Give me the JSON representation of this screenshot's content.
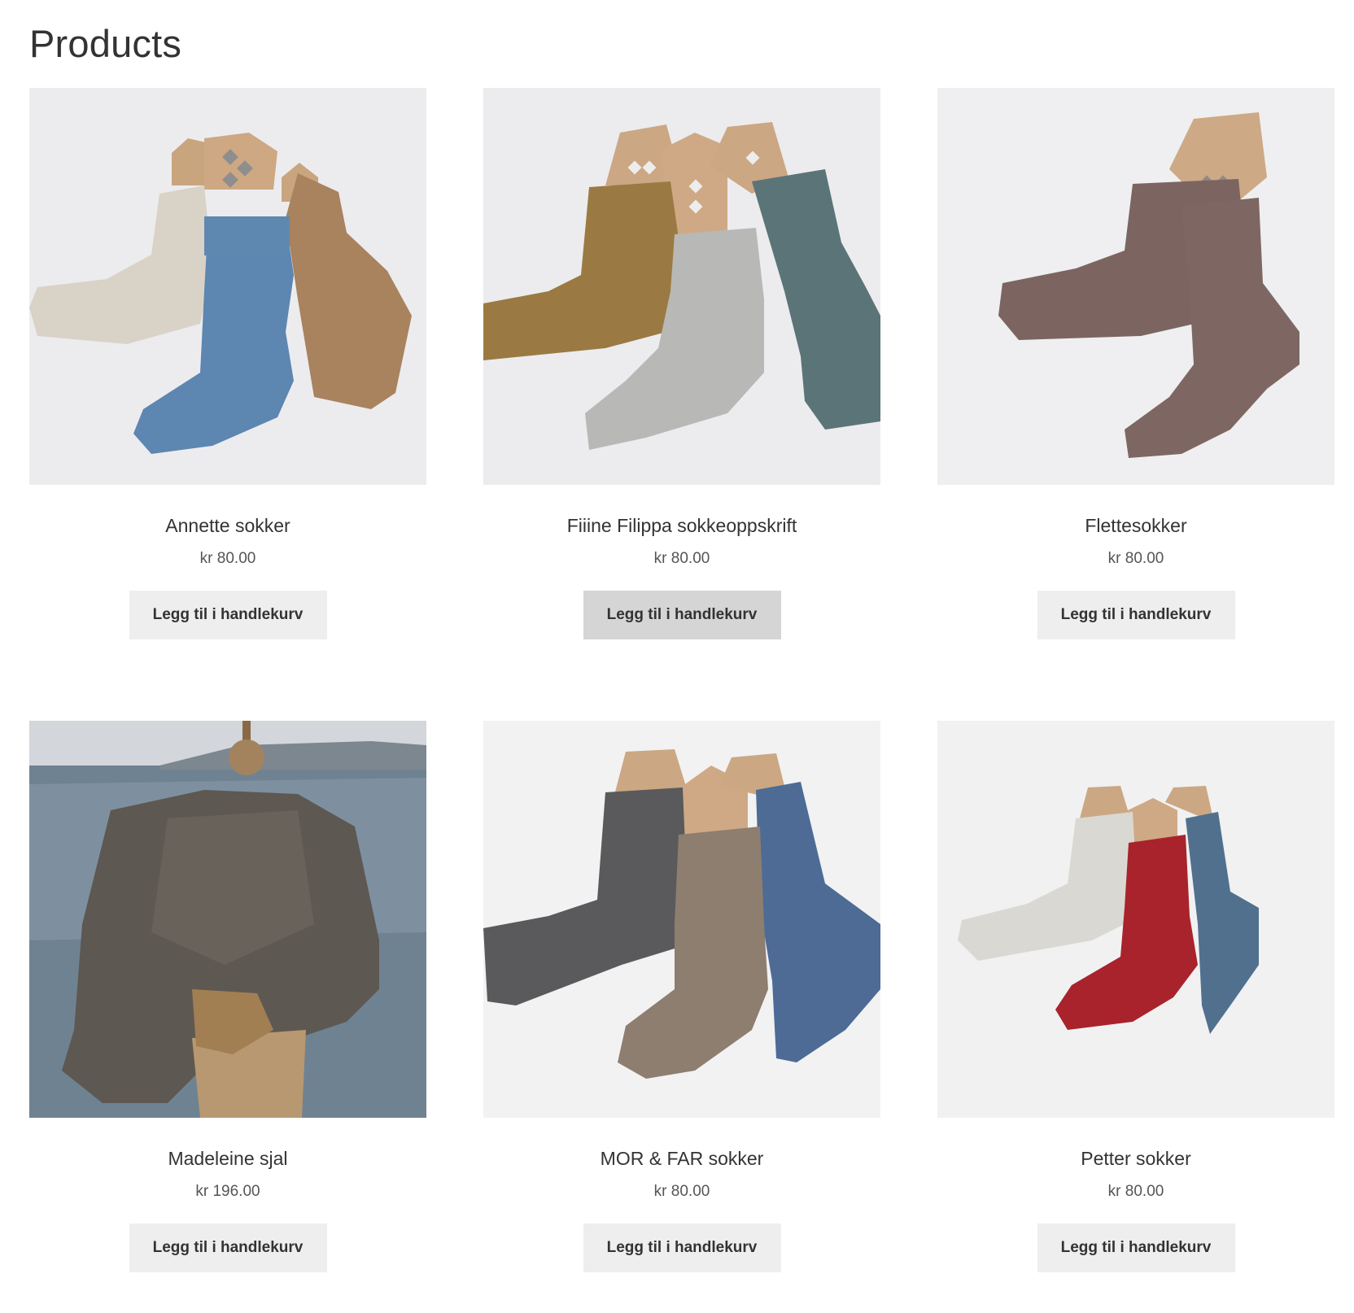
{
  "page": {
    "title": "Products"
  },
  "products": [
    {
      "name": "Annette sokker",
      "currency": "kr",
      "amount": "80.00",
      "button_label": "Legg til i handlekurv",
      "image_icon": "socks-image"
    },
    {
      "name": "Fiiine Filippa sokkeoppskrift",
      "currency": "kr",
      "amount": "80.00",
      "button_label": "Legg til i handlekurv",
      "image_icon": "socks-image"
    },
    {
      "name": "Flettesokker",
      "currency": "kr",
      "amount": "80.00",
      "button_label": "Legg til i handlekurv",
      "image_icon": "socks-image"
    },
    {
      "name": "Madeleine sjal",
      "currency": "kr",
      "amount": "196.00",
      "button_label": "Legg til i handlekurv",
      "image_icon": "shawl-image"
    },
    {
      "name": "MOR & FAR sokker",
      "currency": "kr",
      "amount": "80.00",
      "button_label": "Legg til i handlekurv",
      "image_icon": "socks-image"
    },
    {
      "name": "Petter sokker",
      "currency": "kr",
      "amount": "80.00",
      "button_label": "Legg til i handlekurv",
      "image_icon": "socks-image"
    }
  ],
  "colors": {
    "button_bg": "#eeeeee",
    "button_hover_bg": "#d5d5d5",
    "text": "#333333",
    "price_text": "#555555"
  }
}
